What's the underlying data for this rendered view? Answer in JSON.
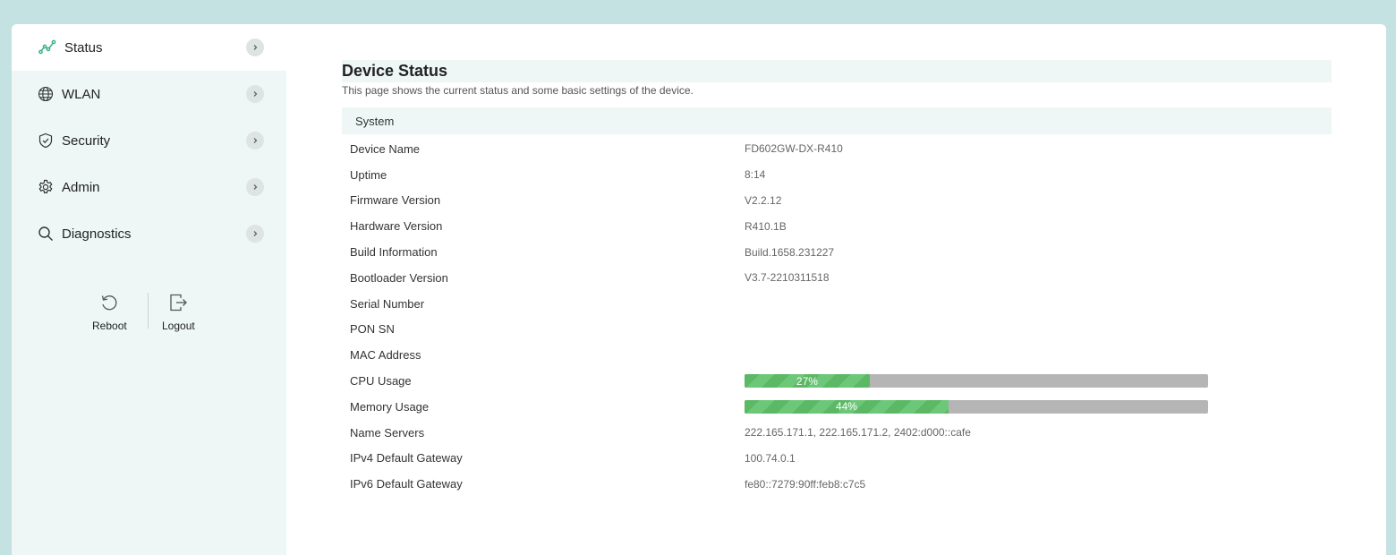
{
  "sidebar": {
    "items": [
      {
        "label": "Status",
        "icon": "chart-line-icon"
      },
      {
        "label": "WLAN",
        "icon": "globe-icon"
      },
      {
        "label": "Security",
        "icon": "shield-icon"
      },
      {
        "label": "Admin",
        "icon": "gear-icon"
      },
      {
        "label": "Diagnostics",
        "icon": "search-icon"
      }
    ],
    "reboot_label": "Reboot",
    "logout_label": "Logout"
  },
  "main": {
    "title": "Device Status",
    "description": "This page shows the current status and some basic settings of the device.",
    "section": "System",
    "rows": [
      {
        "label": "Device Name",
        "value": "FD602GW-DX-R410"
      },
      {
        "label": "Uptime",
        "value": "8:14"
      },
      {
        "label": "Firmware Version",
        "value": "V2.2.12"
      },
      {
        "label": "Hardware Version",
        "value": "R410.1B"
      },
      {
        "label": "Build Information",
        "value": "Build.1658.231227"
      },
      {
        "label": "Bootloader Version",
        "value": "V3.7-2210311518"
      },
      {
        "label": "Serial Number",
        "value": ""
      },
      {
        "label": "PON SN",
        "value": ""
      },
      {
        "label": "MAC Address",
        "value": ""
      },
      {
        "label": "CPU Usage",
        "value": "27%",
        "percent": 27
      },
      {
        "label": "Memory Usage",
        "value": "44%",
        "percent": 44
      },
      {
        "label": "Name Servers",
        "value": "222.165.171.1, 222.165.171.2, 2402:d000::cafe"
      },
      {
        "label": "IPv4 Default Gateway",
        "value": "100.74.0.1"
      },
      {
        "label": "IPv6 Default Gateway",
        "value": "fe80::7279:90ff:feb8:c7c5"
      }
    ]
  },
  "colors": {
    "background": "#c4e2e2",
    "sidebar": "#eef7f6",
    "accent": "#3bb08f",
    "progress": "#5bb865",
    "progress_track": "#b5b5b5"
  }
}
